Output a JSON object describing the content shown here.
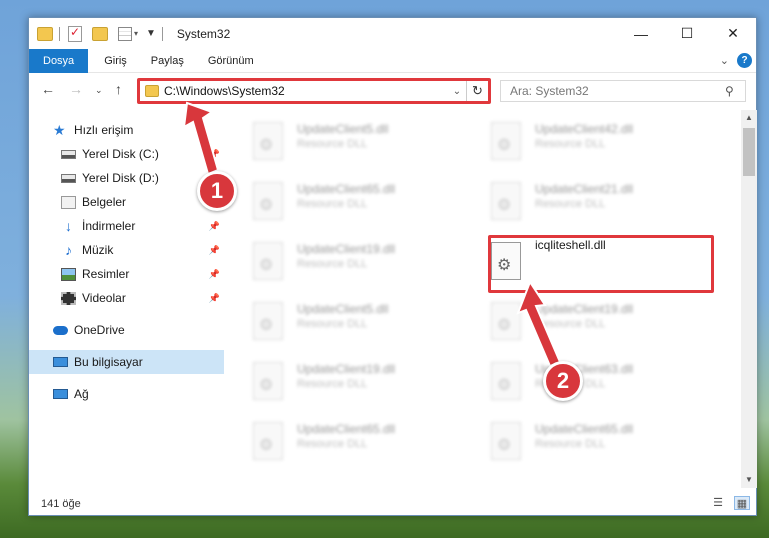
{
  "window": {
    "title": "System32",
    "controls": {
      "minimize": "—",
      "maximize": "☐",
      "close": "✕"
    }
  },
  "ribbon": {
    "tabs": [
      {
        "label": "Dosya",
        "active": true
      },
      {
        "label": "Giriş",
        "active": false
      },
      {
        "label": "Paylaş",
        "active": false
      },
      {
        "label": "Görünüm",
        "active": false
      }
    ],
    "help": "?"
  },
  "navigation": {
    "address": "C:\\Windows\\System32",
    "search_placeholder": "Ara: System32"
  },
  "sidebar": {
    "items": [
      {
        "label": "Hızlı erişim",
        "icon": "star-icon",
        "pinned": false
      },
      {
        "label": "Yerel Disk (C:)",
        "icon": "drive-icon",
        "pinned": true
      },
      {
        "label": "Yerel Disk (D:)",
        "icon": "drive-icon",
        "pinned": false
      },
      {
        "label": "Belgeler",
        "icon": "documents-icon",
        "pinned": true
      },
      {
        "label": "İndirmeler",
        "icon": "download-icon",
        "pinned": true
      },
      {
        "label": "Müzik",
        "icon": "music-icon",
        "pinned": true
      },
      {
        "label": "Resimler",
        "icon": "pictures-icon",
        "pinned": true
      },
      {
        "label": "Videolar",
        "icon": "video-icon",
        "pinned": true
      },
      {
        "label": "OneDrive",
        "icon": "onedrive-icon",
        "pinned": false
      },
      {
        "label": "Bu bilgisayar",
        "icon": "computer-icon",
        "pinned": false,
        "selected": true
      },
      {
        "label": "Ağ",
        "icon": "network-icon",
        "pinned": false
      }
    ]
  },
  "files": [
    {
      "name": "UpdateClient5.dll",
      "type": "Resource DLL"
    },
    {
      "name": "UpdateClient42.dll",
      "type": "Resource DLL"
    },
    {
      "name": "UpdateClient65.dll",
      "type": "Resource DLL"
    },
    {
      "name": "UpdateClient21.dll",
      "type": "Resource DLL"
    },
    {
      "name": "UpdateClient19.dll",
      "type": "Resource DLL"
    },
    {
      "name": "icqliteshell.dll",
      "type": ""
    },
    {
      "name": "UpdateClient5.dll",
      "type": "Resource DLL"
    },
    {
      "name": "UpdateClient19.dll",
      "type": "Resource DLL"
    },
    {
      "name": "UpdateClient19.dll",
      "type": "Resource DLL"
    },
    {
      "name": "UpdateClient63.dll",
      "type": "Resource DLL"
    },
    {
      "name": "UpdateClient65.dll",
      "type": "Resource DLL"
    },
    {
      "name": "UpdateClient65.dll",
      "type": "Resource DLL"
    }
  ],
  "status": {
    "count": "141 öğe"
  },
  "annotations": {
    "badge1": "1",
    "badge2": "2",
    "color": "#d8373c"
  }
}
